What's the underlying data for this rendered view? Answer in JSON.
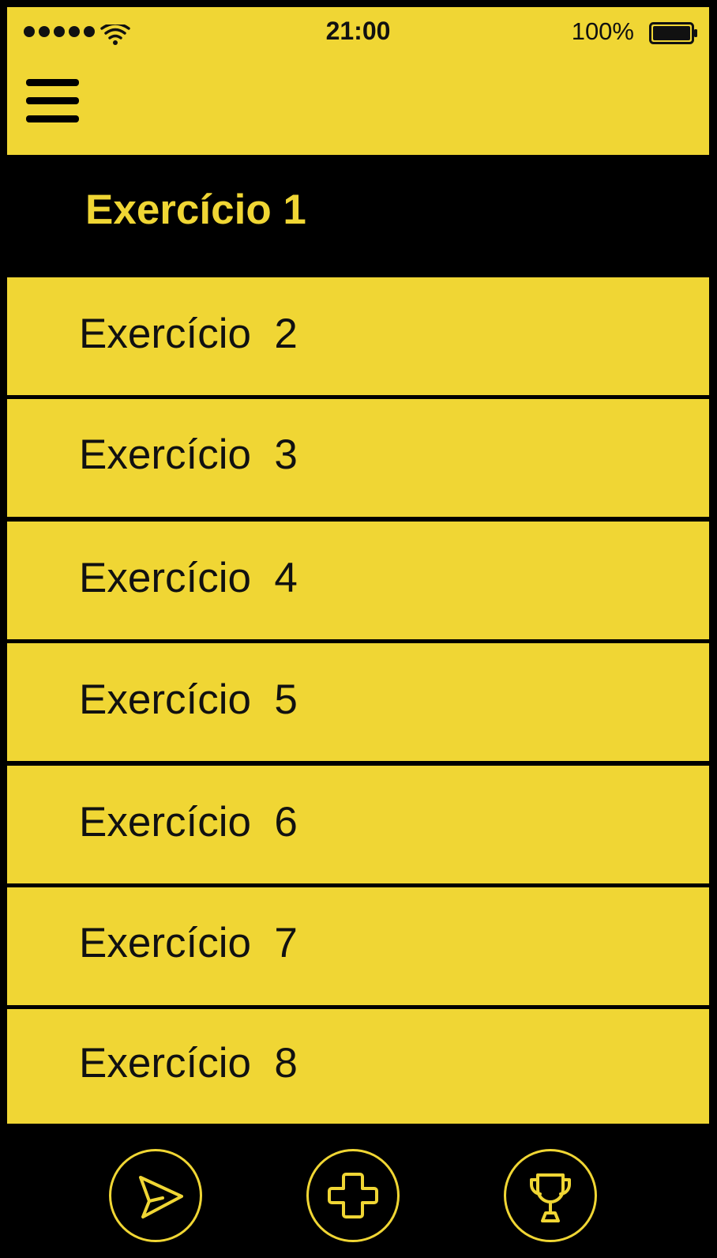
{
  "status_bar": {
    "time": "21:00",
    "battery_percent": "100%",
    "signal_icon": "signal-dots-icon",
    "wifi_icon": "wifi-icon",
    "battery_icon": "battery-full-icon"
  },
  "header": {
    "menu_icon": "hamburger-menu-icon"
  },
  "exercises": [
    {
      "label": "Exercício 1",
      "selected": true
    },
    {
      "label": "Exercício  2",
      "selected": false
    },
    {
      "label": "Exercício  3",
      "selected": false
    },
    {
      "label": "Exercício  4",
      "selected": false
    },
    {
      "label": "Exercício  5",
      "selected": false
    },
    {
      "label": "Exercício  6",
      "selected": false
    },
    {
      "label": "Exercício  7",
      "selected": false
    },
    {
      "label": "Exercício  8",
      "selected": false
    }
  ],
  "tab_bar": {
    "tabs": [
      {
        "icon": "send-icon"
      },
      {
        "icon": "plus-icon"
      },
      {
        "icon": "trophy-icon"
      }
    ]
  },
  "colors": {
    "accent": "#F0D634",
    "dark": "#000000"
  }
}
